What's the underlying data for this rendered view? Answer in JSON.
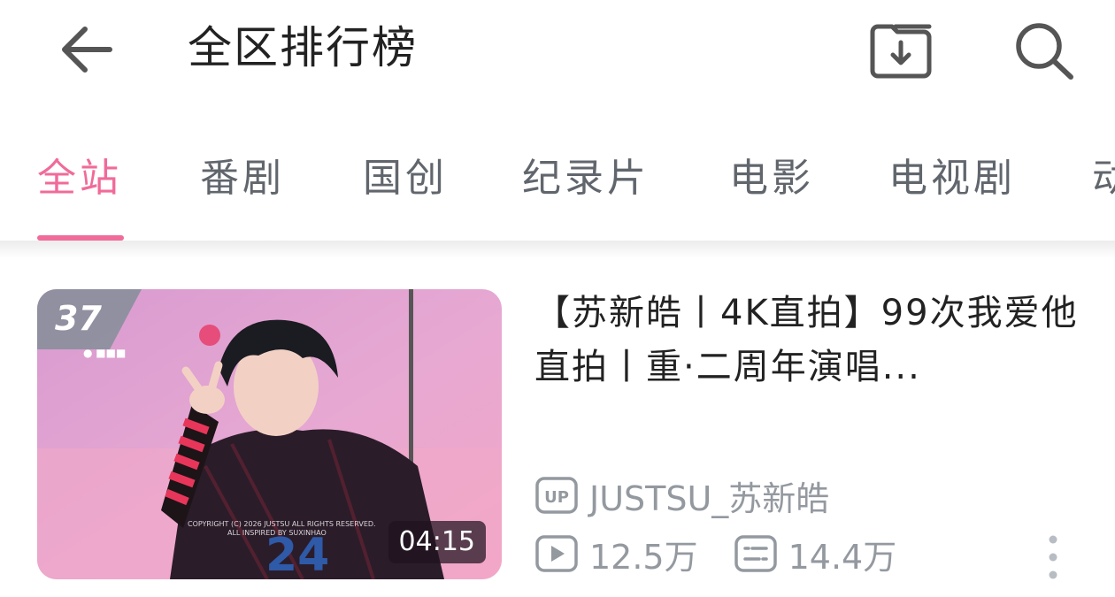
{
  "header": {
    "title": "全区排行榜",
    "back_icon": "arrow-left-icon",
    "download_icon": "download-folder-icon",
    "search_icon": "search-icon"
  },
  "tabs": [
    {
      "label": "全站",
      "active": true
    },
    {
      "label": "番剧",
      "active": false
    },
    {
      "label": "国创",
      "active": false
    },
    {
      "label": "纪录片",
      "active": false
    },
    {
      "label": "电影",
      "active": false
    },
    {
      "label": "电视剧",
      "active": false
    },
    {
      "label": "动",
      "active": false
    }
  ],
  "video": {
    "rank": "37",
    "duration": "04:15",
    "title": "【苏新皓丨4K直拍】99次我爱他 直拍丨重·二周年演唱...",
    "uploader": "JUSTSU_苏新皓",
    "views": "12.5万",
    "danmaku": "14.4万",
    "uploader_badge": "UP"
  },
  "colors": {
    "accent": "#f06b9a",
    "secondary_text": "#9499a0",
    "tab_text": "#61666d"
  }
}
